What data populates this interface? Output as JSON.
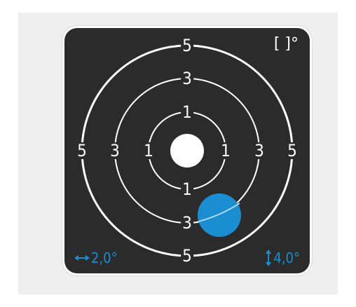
{
  "unit_label": "[ ]°",
  "ring_labels": {
    "outer": "5",
    "middle": "3",
    "inner": "1"
  },
  "horizontal_readout": {
    "icon": "horizontal-double-arrow-icon",
    "value": "2,0°"
  },
  "vertical_readout": {
    "icon": "vertical-double-arrow-icon",
    "value": "4,0°"
  },
  "colors": {
    "background": "#2b2b2b",
    "rings": "#ffffff",
    "marker": "#1a8ed0",
    "accent": "#1a8ed0"
  },
  "marker_offset_deg": {
    "horizontal": 2.0,
    "vertical": 4.0
  }
}
